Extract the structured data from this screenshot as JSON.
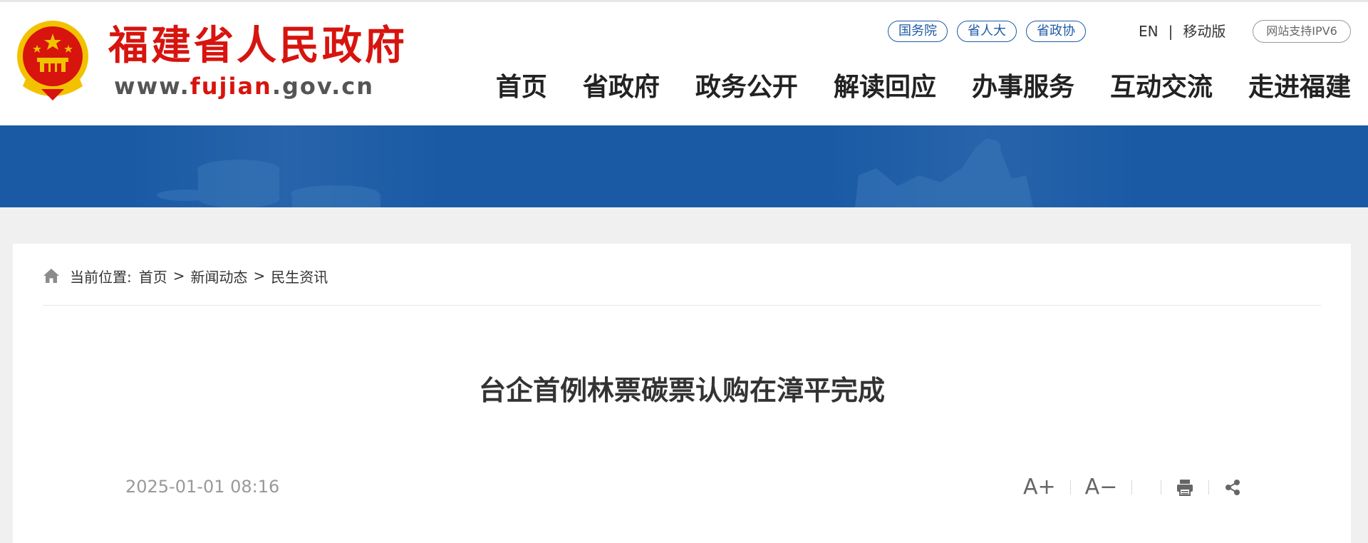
{
  "header": {
    "site_title": "福建省人民政府",
    "site_url_prefix": "www.",
    "site_url_highlight": "fujian",
    "site_url_suffix": ".gov.cn",
    "top_links": [
      "国务院",
      "省人大",
      "省政协"
    ],
    "lang_en": "EN",
    "lang_sep": "|",
    "mobile": "移动版",
    "ipv6": "网站支持IPV6",
    "nav": [
      "首页",
      "省政府",
      "政务公开",
      "解读回应",
      "办事服务",
      "互动交流",
      "走进福建"
    ]
  },
  "breadcrumb": {
    "prefix": "当前位置:",
    "items": [
      "首页",
      "新闻动态",
      "民生资讯"
    ],
    "separator": ">"
  },
  "article": {
    "title": "台企首例林票碳票认购在漳平完成",
    "time": "2025-01-01 08:16"
  },
  "tools": {
    "font_increase": "A+",
    "font_decrease": "A−",
    "print_icon": "print-icon",
    "share_icon": "share-icon"
  },
  "colors": {
    "brand_red": "#d7140e",
    "brand_blue": "#1a5aa5"
  }
}
